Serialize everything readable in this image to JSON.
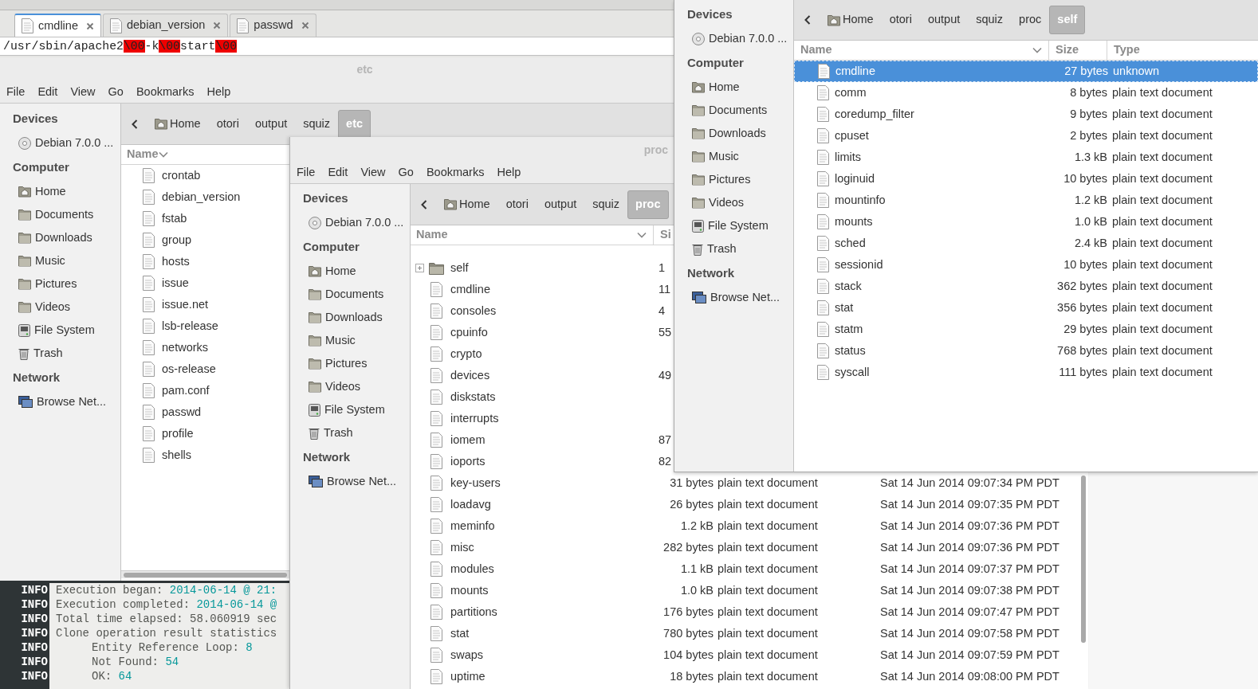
{
  "editor": {
    "tabs": [
      {
        "label": "cmdline",
        "selected": true
      },
      {
        "label": "debian_version",
        "selected": false
      },
      {
        "label": "passwd",
        "selected": false
      }
    ],
    "content": [
      {
        "kind": "text",
        "text": "/usr/sbin/apache2"
      },
      {
        "kind": "escape",
        "text": "\\00"
      },
      {
        "kind": "text",
        "text": "-k"
      },
      {
        "kind": "escape",
        "text": "\\00"
      },
      {
        "kind": "text",
        "text": "start"
      },
      {
        "kind": "escape",
        "text": "\\00"
      }
    ]
  },
  "etc_window": {
    "title": "etc",
    "menu": [
      "File",
      "Edit",
      "View",
      "Go",
      "Bookmarks",
      "Help"
    ],
    "sidebar": [
      {
        "heading": "Devices",
        "items": [
          {
            "kind": "disc",
            "label": "Debian 7.0.0 ..."
          }
        ]
      },
      {
        "heading": "Computer",
        "items": [
          {
            "kind": "home",
            "label": "Home"
          },
          {
            "kind": "folder",
            "label": "Documents"
          },
          {
            "kind": "folder",
            "label": "Downloads"
          },
          {
            "kind": "folder",
            "label": "Music"
          },
          {
            "kind": "folder",
            "label": "Pictures"
          },
          {
            "kind": "folder",
            "label": "Videos"
          },
          {
            "kind": "drive",
            "label": "File System"
          },
          {
            "kind": "trash",
            "label": "Trash"
          }
        ]
      },
      {
        "heading": "Network",
        "items": [
          {
            "kind": "network",
            "label": "Browse Net..."
          }
        ]
      }
    ],
    "path": [
      {
        "kind": "home",
        "label": "Home",
        "selected": false
      },
      {
        "kind": "dir",
        "label": "otori",
        "selected": false
      },
      {
        "kind": "dir",
        "label": "output",
        "selected": false
      },
      {
        "kind": "dir",
        "label": "squiz",
        "selected": false
      },
      {
        "kind": "dir",
        "label": "etc",
        "selected": true
      }
    ],
    "columns": [
      "Name"
    ],
    "files": [
      {
        "kind": "file",
        "name": "crontab",
        "selected": false
      },
      {
        "kind": "file",
        "name": "debian_version",
        "selected": false
      },
      {
        "kind": "file",
        "name": "fstab",
        "selected": false
      },
      {
        "kind": "file",
        "name": "group",
        "selected": false
      },
      {
        "kind": "file",
        "name": "hosts",
        "selected": false
      },
      {
        "kind": "file",
        "name": "issue",
        "selected": false
      },
      {
        "kind": "file",
        "name": "issue.net",
        "selected": false
      },
      {
        "kind": "file",
        "name": "lsb-release",
        "selected": false
      },
      {
        "kind": "file",
        "name": "networks",
        "selected": false
      },
      {
        "kind": "file",
        "name": "os-release",
        "selected": false
      },
      {
        "kind": "file",
        "name": "pam.conf",
        "selected": false
      },
      {
        "kind": "file",
        "name": "passwd",
        "selected": false
      },
      {
        "kind": "file",
        "name": "profile",
        "selected": false
      },
      {
        "kind": "file",
        "name": "shells",
        "selected": false
      }
    ]
  },
  "terminal": {
    "lines": [
      {
        "level": "INFO",
        "label": "Execution began: ",
        "value": "2014-06-14 @ 21:"
      },
      {
        "level": "INFO",
        "label": "Execution completed: ",
        "value": "2014-06-14 @"
      },
      {
        "level": "INFO",
        "label": "Total time elapsed: 58.060919 sec"
      },
      {
        "level": "INFO",
        "label": "Clone operation result statistics",
        "children": [
          {
            "level": "INFO",
            "label": "Entity Reference Loop: ",
            "value": "8"
          },
          {
            "level": "INFO",
            "label": "Not Found: ",
            "value": "54"
          },
          {
            "level": "INFO",
            "label": "OK: ",
            "value": "64"
          }
        ]
      }
    ]
  },
  "proc_window": {
    "title": "proc",
    "menu": [
      "File",
      "Edit",
      "View",
      "Go",
      "Bookmarks",
      "Help"
    ],
    "sidebar": [
      {
        "heading": "Devices",
        "items": [
          {
            "kind": "disc",
            "label": "Debian 7.0.0 ..."
          }
        ]
      },
      {
        "heading": "Computer",
        "items": [
          {
            "kind": "home",
            "label": "Home"
          },
          {
            "kind": "folder",
            "label": "Documents"
          },
          {
            "kind": "folder",
            "label": "Downloads"
          },
          {
            "kind": "folder",
            "label": "Music"
          },
          {
            "kind": "folder",
            "label": "Pictures"
          },
          {
            "kind": "folder",
            "label": "Videos"
          },
          {
            "kind": "drive",
            "label": "File System"
          },
          {
            "kind": "trash",
            "label": "Trash"
          }
        ]
      },
      {
        "heading": "Network",
        "items": [
          {
            "kind": "network",
            "label": "Browse Net..."
          }
        ]
      }
    ],
    "path": [
      {
        "kind": "home",
        "label": "Home",
        "selected": false
      },
      {
        "kind": "dir",
        "label": "otori",
        "selected": false
      },
      {
        "kind": "dir",
        "label": "output",
        "selected": false
      },
      {
        "kind": "dir",
        "label": "squiz",
        "selected": false
      },
      {
        "kind": "dir",
        "label": "proc",
        "selected": true
      }
    ],
    "columns": [
      "Name",
      "Si"
    ],
    "files": [
      {
        "kind": "folder",
        "name": "self",
        "size": "1",
        "selected": false
      },
      {
        "kind": "file",
        "name": "cmdline",
        "size": "11",
        "selected": false
      },
      {
        "kind": "file",
        "name": "consoles",
        "size": "4",
        "selected": false
      },
      {
        "kind": "file",
        "name": "cpuinfo",
        "size": "55",
        "selected": false
      },
      {
        "kind": "file",
        "name": "crypto",
        "selected": false
      },
      {
        "kind": "file",
        "name": "devices",
        "size": "49",
        "selected": false
      },
      {
        "kind": "file",
        "name": "diskstats",
        "selected": false
      },
      {
        "kind": "file",
        "name": "interrupts",
        "selected": false
      },
      {
        "kind": "file",
        "name": "iomem",
        "size": "87",
        "selected": false
      },
      {
        "kind": "file",
        "name": "ioports",
        "size": "82",
        "selected": false
      },
      {
        "kind": "file",
        "name": "key-users",
        "size": "31 bytes",
        "type": "plain text document",
        "modified": "Sat 14 Jun 2014 09:07:34 PM PDT",
        "selected": false
      },
      {
        "kind": "file",
        "name": "loadavg",
        "size": "26 bytes",
        "type": "plain text document",
        "modified": "Sat 14 Jun 2014 09:07:35 PM PDT",
        "selected": false
      },
      {
        "kind": "file",
        "name": "meminfo",
        "size": "1.2 kB",
        "type": "plain text document",
        "modified": "Sat 14 Jun 2014 09:07:36 PM PDT",
        "selected": false
      },
      {
        "kind": "file",
        "name": "misc",
        "size": "282 bytes",
        "type": "plain text document",
        "modified": "Sat 14 Jun 2014 09:07:36 PM PDT",
        "selected": false
      },
      {
        "kind": "file",
        "name": "modules",
        "size": "1.1 kB",
        "type": "plain text document",
        "modified": "Sat 14 Jun 2014 09:07:37 PM PDT",
        "selected": false
      },
      {
        "kind": "file",
        "name": "mounts",
        "size": "1.0 kB",
        "type": "plain text document",
        "modified": "Sat 14 Jun 2014 09:07:38 PM PDT",
        "selected": false
      },
      {
        "kind": "file",
        "name": "partitions",
        "size": "176 bytes",
        "type": "plain text document",
        "modified": "Sat 14 Jun 2014 09:07:47 PM PDT",
        "selected": false
      },
      {
        "kind": "file",
        "name": "stat",
        "size": "780 bytes",
        "type": "plain text document",
        "modified": "Sat 14 Jun 2014 09:07:58 PM PDT",
        "selected": false
      },
      {
        "kind": "file",
        "name": "swaps",
        "size": "104 bytes",
        "type": "plain text document",
        "modified": "Sat 14 Jun 2014 09:07:59 PM PDT",
        "selected": false
      },
      {
        "kind": "file",
        "name": "uptime",
        "size": "18 bytes",
        "type": "plain text document",
        "modified": "Sat 14 Jun 2014 09:08:00 PM PDT",
        "selected": false
      }
    ]
  },
  "self_window": {
    "sidebar": [
      {
        "heading": "Devices",
        "items": [
          {
            "kind": "disc",
            "label": "Debian 7.0.0 ..."
          }
        ]
      },
      {
        "heading": "Computer",
        "items": [
          {
            "kind": "home",
            "label": "Home"
          },
          {
            "kind": "folder",
            "label": "Documents"
          },
          {
            "kind": "folder",
            "label": "Downloads"
          },
          {
            "kind": "folder",
            "label": "Music"
          },
          {
            "kind": "folder",
            "label": "Pictures"
          },
          {
            "kind": "folder",
            "label": "Videos"
          },
          {
            "kind": "drive",
            "label": "File System"
          },
          {
            "kind": "trash",
            "label": "Trash"
          }
        ]
      },
      {
        "heading": "Network",
        "items": [
          {
            "kind": "network",
            "label": "Browse Net..."
          }
        ]
      }
    ],
    "path": [
      {
        "kind": "home",
        "label": "Home",
        "selected": false
      },
      {
        "kind": "dir",
        "label": "otori",
        "selected": false
      },
      {
        "kind": "dir",
        "label": "output",
        "selected": false
      },
      {
        "kind": "dir",
        "label": "squiz",
        "selected": false
      },
      {
        "kind": "dir",
        "label": "proc",
        "selected": false
      },
      {
        "kind": "dir",
        "label": "self",
        "selected": true
      }
    ],
    "columns": [
      "Name",
      "Size",
      "Type"
    ],
    "files": [
      {
        "kind": "file",
        "name": "cmdline",
        "size": "27 bytes",
        "type": "unknown",
        "selected": true
      },
      {
        "kind": "file",
        "name": "comm",
        "size": "8 bytes",
        "type": "plain text document",
        "selected": false
      },
      {
        "kind": "file",
        "name": "coredump_filter",
        "size": "9 bytes",
        "type": "plain text document",
        "selected": false
      },
      {
        "kind": "file",
        "name": "cpuset",
        "size": "2 bytes",
        "type": "plain text document",
        "selected": false
      },
      {
        "kind": "file",
        "name": "limits",
        "size": "1.3 kB",
        "type": "plain text document",
        "selected": false
      },
      {
        "kind": "file",
        "name": "loginuid",
        "size": "10 bytes",
        "type": "plain text document",
        "selected": false
      },
      {
        "kind": "file",
        "name": "mountinfo",
        "size": "1.2 kB",
        "type": "plain text document",
        "selected": false
      },
      {
        "kind": "file",
        "name": "mounts",
        "size": "1.0 kB",
        "type": "plain text document",
        "selected": false
      },
      {
        "kind": "file",
        "name": "sched",
        "size": "2.4 kB",
        "type": "plain text document",
        "selected": false
      },
      {
        "kind": "file",
        "name": "sessionid",
        "size": "10 bytes",
        "type": "plain text document",
        "selected": false
      },
      {
        "kind": "file",
        "name": "stack",
        "size": "362 bytes",
        "type": "plain text document",
        "selected": false
      },
      {
        "kind": "file",
        "name": "stat",
        "size": "356 bytes",
        "type": "plain text document",
        "selected": false
      },
      {
        "kind": "file",
        "name": "statm",
        "size": "29 bytes",
        "type": "plain text document",
        "selected": false
      },
      {
        "kind": "file",
        "name": "status",
        "size": "768 bytes",
        "type": "plain text document",
        "selected": false
      },
      {
        "kind": "file",
        "name": "syscall",
        "size": "111 bytes",
        "type": "plain text document",
        "selected": false
      }
    ]
  }
}
